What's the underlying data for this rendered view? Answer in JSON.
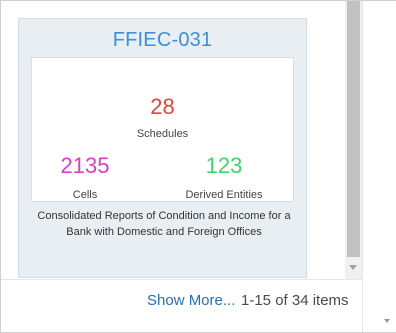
{
  "card": {
    "title": "FFIEC-031",
    "schedules": {
      "value": "28",
      "label": "Schedules"
    },
    "cells": {
      "value": "2135",
      "label": "Cells"
    },
    "derived_entities": {
      "value": "123",
      "label": "Derived Entities"
    },
    "description": "Consolidated Reports of Condition and Income for a Bank with Domestic and Foreign Offices"
  },
  "footer": {
    "show_more": "Show More...",
    "range": "1-15 of 34 items"
  },
  "colors": {
    "title": "#3d8fd8",
    "schedules": "#e5423a",
    "cells": "#e23ac7",
    "derived_entities": "#3fd66a",
    "link": "#2670b3"
  }
}
